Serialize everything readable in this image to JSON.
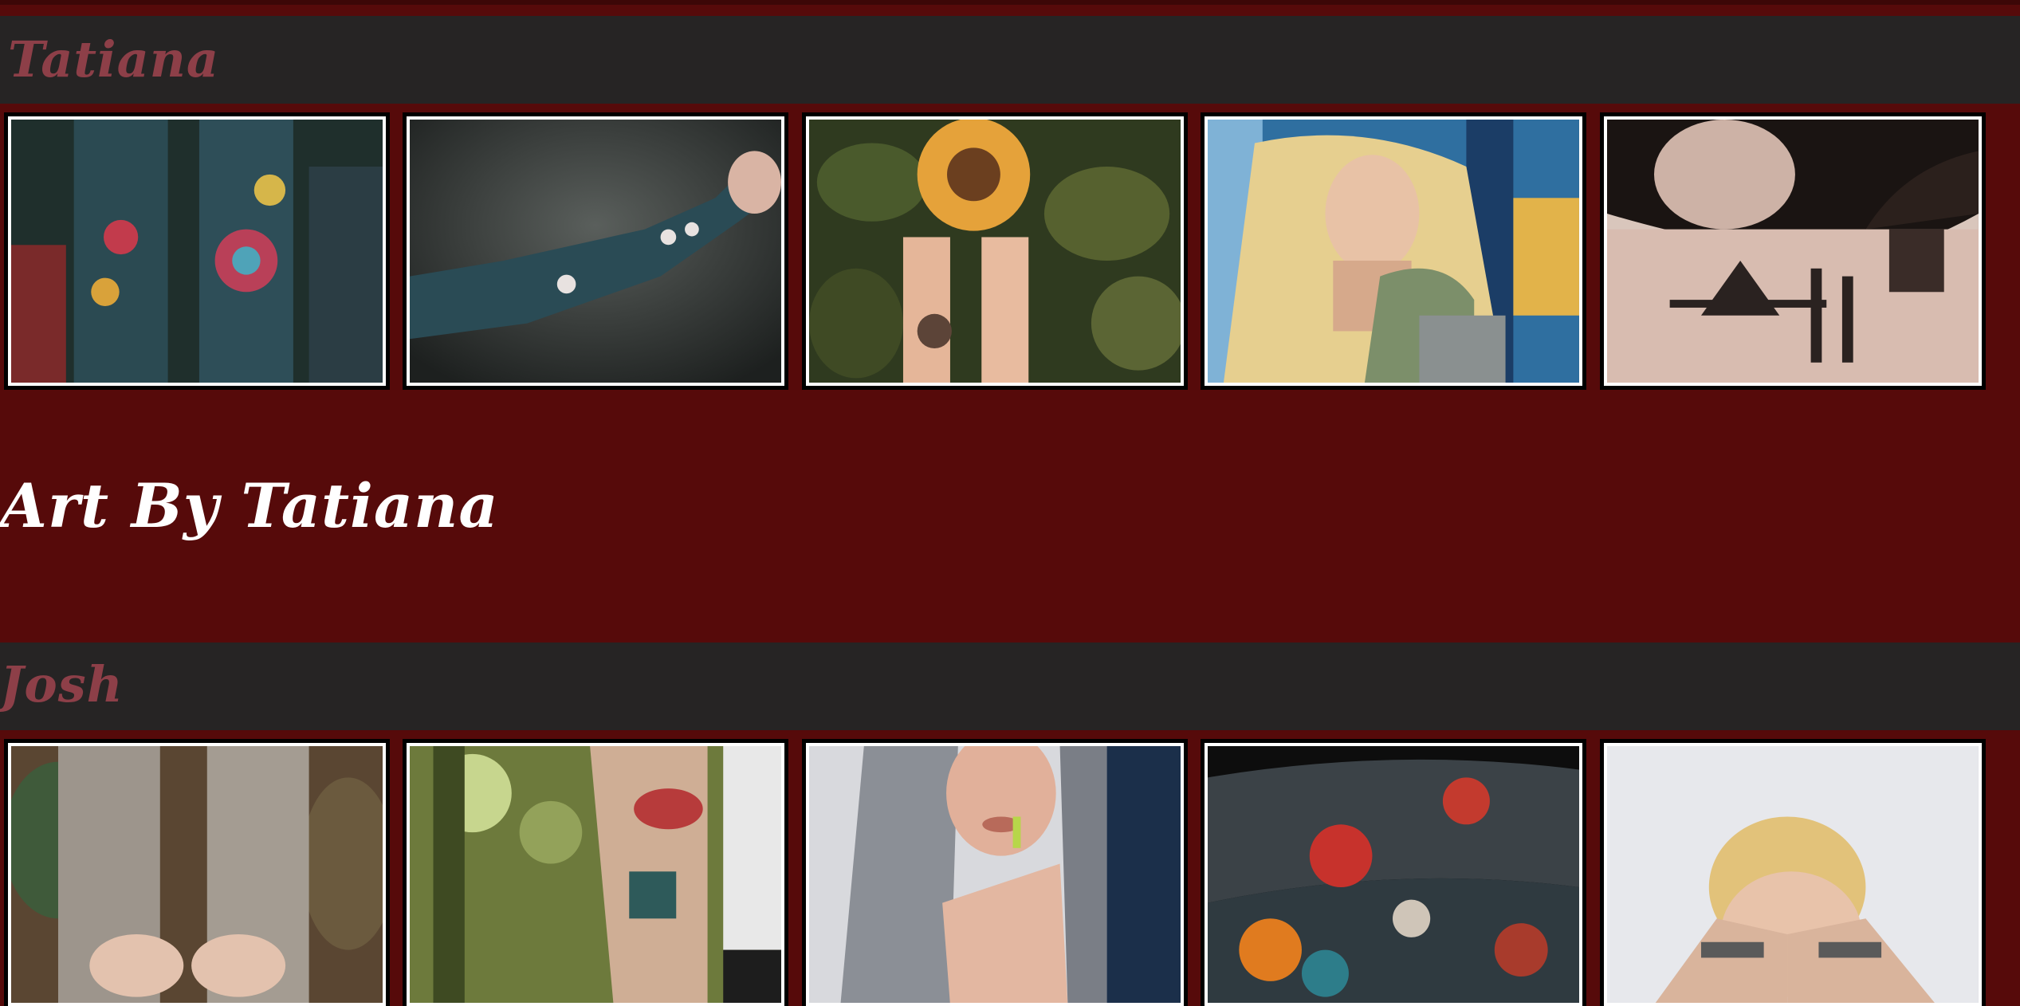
{
  "artists": [
    {
      "name": "Tatiana",
      "photos": [
        {
          "alt_name": "tattooed-arms-floral"
        },
        {
          "alt_name": "tattooed-arm-fist"
        },
        {
          "alt_name": "sunflower-tattoo-hands"
        },
        {
          "alt_name": "blonde-woman-neck-tattoo"
        },
        {
          "alt_name": "back-neck-script-tattoo"
        }
      ]
    },
    {
      "name": "Josh",
      "photos": [
        {
          "alt_name": "sleeve-tattoo-hands"
        },
        {
          "alt_name": "lips-tattoo-arm"
        },
        {
          "alt_name": "braids-woman-hand-tattoo"
        },
        {
          "alt_name": "japanese-sleeve-tattoo"
        },
        {
          "alt_name": "blonde-hands-over-eyes"
        }
      ]
    }
  ],
  "section_heading": "Art By Tatiana",
  "colors": {
    "background": "#560a0a",
    "bar": "#262424",
    "artist_name": "#8d3f48",
    "heading": "#ffffff"
  }
}
